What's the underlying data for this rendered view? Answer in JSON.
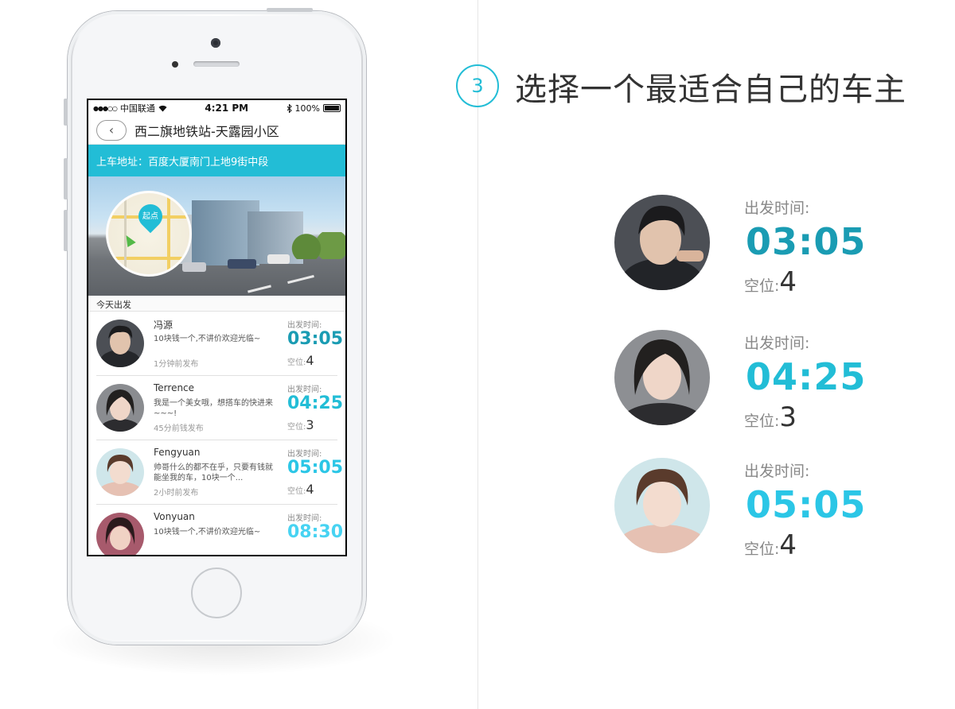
{
  "colors": {
    "accent": "#22bdd6",
    "time_1": "#1a9cb3",
    "time_2": "#22bdd6",
    "time_3": "#2bc6e6",
    "time_4": "#47d3f2"
  },
  "step": {
    "number": "3",
    "title": "选择一个最适合自己的车主"
  },
  "phone": {
    "status": {
      "carrier": "中国联通",
      "time": "4:21 PM",
      "battery": "100%"
    },
    "nav": {
      "back_icon": "‹",
      "title": "西二旗地铁站-天露园小区"
    },
    "pickup": {
      "text": "上车地址：百度大厦南门上地9街中段"
    },
    "map": {
      "pin_label": "起点"
    },
    "section_title": "今天出发",
    "rides": [
      {
        "name": "冯源",
        "message": "10块钱一个,不讲价欢迎光临~",
        "posted": "1分钟前发布",
        "depart_label": "出发时间:",
        "time": "03:05",
        "seats_label": "空位:",
        "seats": "4"
      },
      {
        "name": "Terrence",
        "message": "我是一个美女哦，想搭车的快进来~~~!",
        "posted": "45分前钱发布",
        "depart_label": "出发时间:",
        "time": "04:25",
        "seats_label": "空位:",
        "seats": "3"
      },
      {
        "name": "Fengyuan",
        "message": "帅哥什么的都不在乎，只要有钱就能坐我的车，10块一个...",
        "posted": "2小时前发布",
        "depart_label": "出发时间:",
        "time": "05:05",
        "seats_label": "空位:",
        "seats": "4"
      },
      {
        "name": "Vonyuan",
        "message": "10块钱一个,不讲价欢迎光临~",
        "posted": "",
        "depart_label": "出发时间:",
        "time": "08:30",
        "seats_label": "",
        "seats": ""
      }
    ]
  },
  "drivers": [
    {
      "depart_label": "出发时间:",
      "time": "03:05",
      "seats_label": "空位:",
      "seats": "4"
    },
    {
      "depart_label": "出发时间:",
      "time": "04:25",
      "seats_label": "空位:",
      "seats": "3"
    },
    {
      "depart_label": "出发时间:",
      "time": "05:05",
      "seats_label": "空位:",
      "seats": "4"
    }
  ]
}
